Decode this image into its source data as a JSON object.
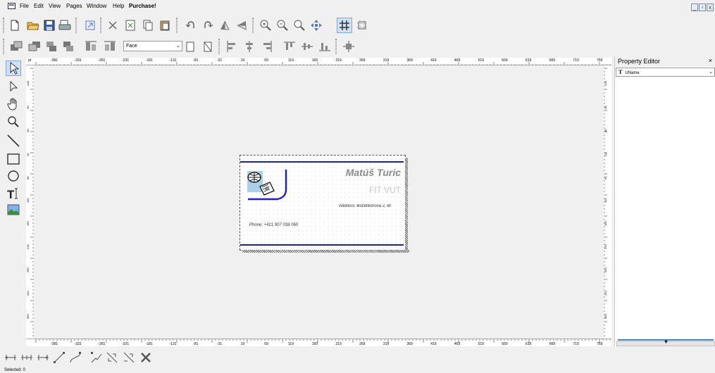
{
  "menubar": {
    "items": [
      "File",
      "Edit",
      "View",
      "Pages",
      "Window",
      "Help",
      "Purchase!"
    ]
  },
  "window_controls": [
    "_",
    "Ɖ",
    "x"
  ],
  "toolbar1": {
    "icons": [
      "new-document-icon",
      "open-folder-icon",
      "save-icon",
      "print-icon",
      "export-icon",
      "delete-icon",
      "cut-icon",
      "copy-icon",
      "paste-icon",
      "undo-icon",
      "redo-icon",
      "flip-vertical-icon",
      "flip-horizontal-icon",
      "zoom-in-icon",
      "zoom-out-icon",
      "zoom-fit-icon",
      "move-icon",
      "grid-icon",
      "snap-icon"
    ]
  },
  "toolbar2": {
    "face_select": "Face",
    "icons": [
      "bring-to-front-icon",
      "send-to-back-icon",
      "bring-forward-icon",
      "send-backward-icon",
      "group-icon",
      "ungroup-icon",
      "face-front-icon",
      "face-back-icon",
      "align-left-icon",
      "align-center-icon",
      "align-right-icon",
      "align-top-icon",
      "align-middle-icon",
      "align-bottom-icon",
      "center-icon"
    ]
  },
  "tools": [
    "select-arrow-icon",
    "direct-select-icon",
    "hand-pan-icon",
    "zoom-tool-icon",
    "line-tool-icon",
    "rectangle-tool-icon",
    "ellipse-tool-icon",
    "text-tool-icon",
    "image-tool-icon"
  ],
  "ruler": {
    "unit": "pt",
    "top_labels": [
      "-381",
      "-331",
      "-281",
      "-231",
      "-181",
      "-131",
      "-81",
      "-31",
      "19",
      "69",
      "119",
      "169",
      "219",
      "269",
      "319",
      "369",
      "419",
      "469",
      "519",
      "569",
      "619",
      "669",
      "719",
      "769"
    ],
    "bottom_labels": [
      "-381",
      "-331",
      "-281",
      "-231",
      "-181",
      "-131",
      "-81",
      "-31",
      "19",
      "69",
      "119",
      "169",
      "219",
      "269",
      "319",
      "369",
      "419",
      "469",
      "519",
      "569",
      "619",
      "669",
      "719",
      "769"
    ],
    "left_labels": [
      "-140",
      "-90",
      "-40",
      "10",
      "60",
      "110",
      "160",
      "210",
      "260",
      "310",
      "360"
    ],
    "right_labels": [
      "-140",
      "-90",
      "-40",
      "10",
      "60",
      "110",
      "160",
      "210",
      "260",
      "310",
      "360"
    ]
  },
  "card": {
    "name": "Matúš Turic",
    "organization": "FIT VUT",
    "address": "Address: Božetěchova 2, Br",
    "phone": "Phone:  +421 907 038 060",
    "line_color": "#1c1cc8"
  },
  "property_editor": {
    "title": "Property Editor",
    "close": "×",
    "combo_value": "UName",
    "scroll_arrow": "▼"
  },
  "bottom_toolbar": {
    "icons": [
      "distribute-left-icon",
      "distribute-center-icon",
      "distribute-right-icon",
      "connector-line-icon",
      "connector-curve-icon",
      "connector-elbow-icon",
      "connector-cross-icon",
      "connector-diagonal-icon",
      "remove-connector-icon"
    ]
  },
  "status": {
    "text": "Selected: 0"
  }
}
